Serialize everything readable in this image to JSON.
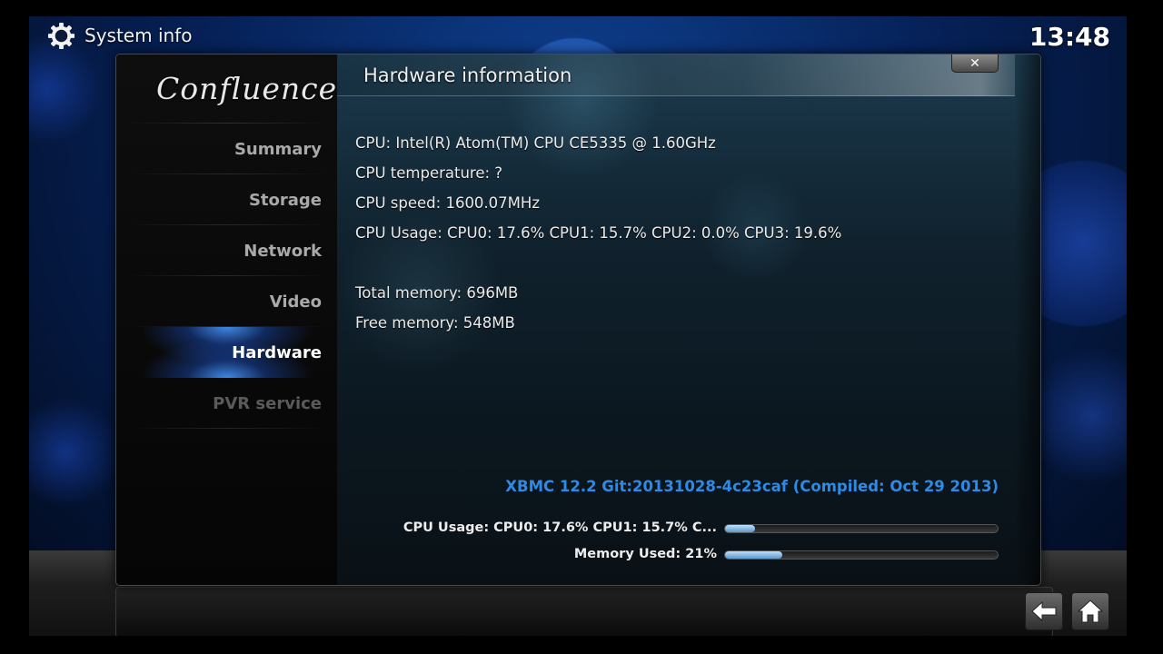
{
  "header": {
    "title": "System info",
    "clock": "13:48",
    "icon": "gear-icon"
  },
  "sidebar": {
    "logo_text": "Confluence",
    "items": [
      {
        "label": "Summary",
        "state": "normal"
      },
      {
        "label": "Storage",
        "state": "normal"
      },
      {
        "label": "Network",
        "state": "normal"
      },
      {
        "label": "Video",
        "state": "normal"
      },
      {
        "label": "Hardware",
        "state": "selected"
      },
      {
        "label": "PVR service",
        "state": "disabled"
      }
    ]
  },
  "content": {
    "title": "Hardware information",
    "close_label": "✕",
    "lines": [
      "CPU: Intel(R) Atom(TM) CPU CE5335   @ 1.60GHz",
      "CPU temperature: ?",
      "CPU speed: 1600.07MHz",
      "CPU Usage: CPU0: 17.6% CPU1: 15.7% CPU2: 0.0% CPU3: 19.6%",
      "Total memory: 696MB",
      "Free memory: 548MB"
    ],
    "build": "XBMC 12.2 Git:20131028-4c23caf (Compiled: Oct 29 2013)",
    "bars": [
      {
        "label": "CPU Usage: CPU0: 17.6% CPU1: 15.7% C...",
        "fraction": 0.11
      },
      {
        "label": "Memory Used: 21%",
        "fraction": 0.21
      }
    ]
  },
  "footer": {
    "back_icon": "back-arrow-icon",
    "home_icon": "home-icon"
  },
  "colors": {
    "accent": "#2d8ae6",
    "selected_glow": "#3a8cff",
    "bar_fill": "#7fb6e6"
  }
}
